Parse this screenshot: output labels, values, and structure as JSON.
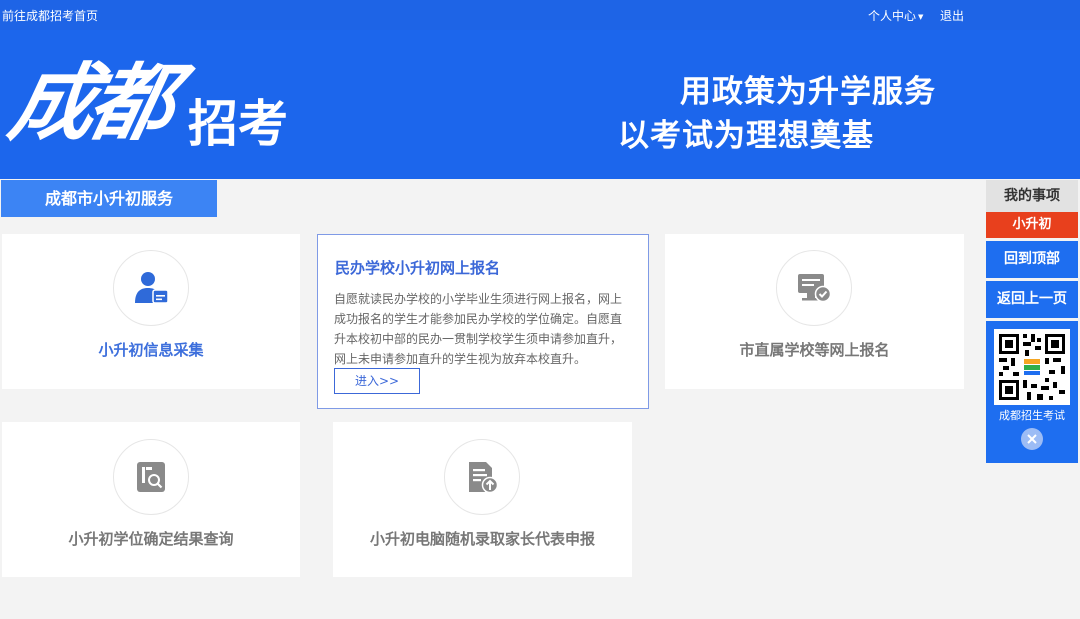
{
  "topbar": {
    "home_link": "前往成都招考首页",
    "user_center": "个人中心",
    "logout": "退出"
  },
  "banner": {
    "logo_script": "成都",
    "logo_text": "招考",
    "slogan_line1": "用政策为升学服务",
    "slogan_line2": "以考试为理想奠基"
  },
  "section": {
    "tab_label": "成都市小升初服务"
  },
  "cards": {
    "info_collect": "小升初信息采集",
    "private_reg": {
      "title": "民办学校小升初网上报名",
      "text": "自愿就读民办学校的小学毕业生须进行网上报名，网上成功报名的学生才能参加民办学校的学位确定。自愿直升本校初中部的民办一贯制学校学生须申请参加直升，网上未申请参加直升的学生视为放弃本校直升。",
      "enter": "进入>>"
    },
    "city_reg": "市直属学校等网上报名",
    "result_query": "小升初学位确定结果查询",
    "parent_rep": "小升初电脑随机录取家长代表申报"
  },
  "sidebar": {
    "title": "我的事项",
    "tag": "小升初",
    "back_top": "回到顶部",
    "back_prev": "返回上一页",
    "qr_label": "成都招生考试"
  },
  "colors": {
    "brand_blue": "#1c66ec",
    "accent_red": "#e8401d"
  },
  "icons": [
    "user-card-icon",
    "monitor-check-icon",
    "document-search-icon",
    "document-upload-icon",
    "qr-code-icon",
    "close-icon"
  ]
}
